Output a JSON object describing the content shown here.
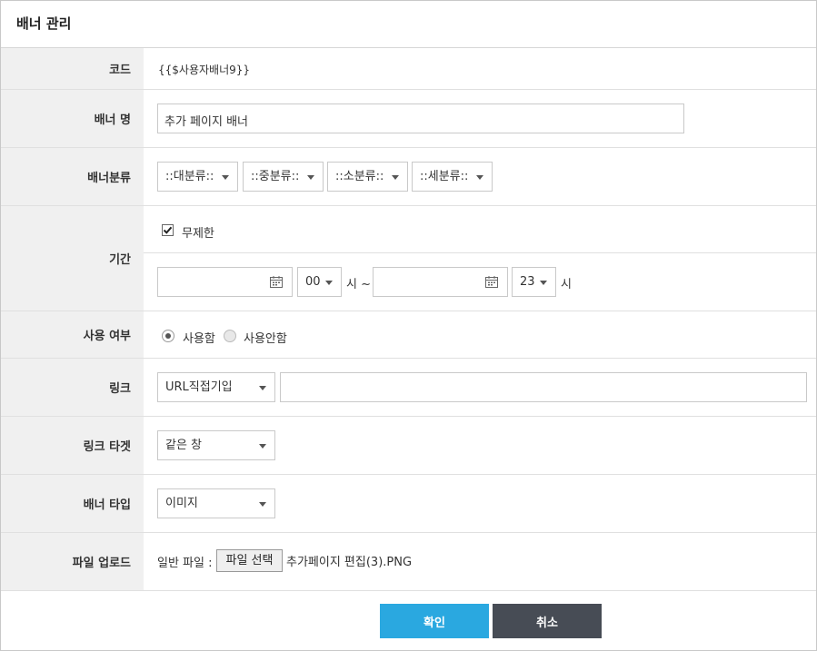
{
  "dialog": {
    "title": "배너 관리"
  },
  "code": {
    "label": "코드",
    "value": "{{$사용자배너9}}"
  },
  "name": {
    "label": "배너 명",
    "value": "추가 페이지 배너"
  },
  "category": {
    "label": "배너분류",
    "large": "::대분류::",
    "medium": "::중분류::",
    "small": "::소분류::",
    "detail": "::세분류::"
  },
  "period": {
    "label": "기간",
    "unlimited_label": "무제한",
    "unlimited_checked": true,
    "start_date": "",
    "start_hour": "00",
    "hour_unit_start": "시 ~",
    "end_date": "",
    "end_hour": "23",
    "hour_unit_end": "시"
  },
  "usage": {
    "label": "사용 여부",
    "option_use": "사용함",
    "option_nouse": "사용안함",
    "selected": "사용함"
  },
  "link": {
    "label": "링크",
    "type": "URL직접기입",
    "url": ""
  },
  "link_target": {
    "label": "링크 타겟",
    "value": "같은 창"
  },
  "banner_type": {
    "label": "배너 타입",
    "value": "이미지"
  },
  "file_upload": {
    "label": "파일 업로드",
    "prefix": "일반 파일 :",
    "choose_label": "파일 선택",
    "file_name": "추가페이지 편집(3).PNG"
  },
  "actions": {
    "confirm": "확인",
    "cancel": "취소"
  },
  "colors": {
    "confirm": "#2aa8e0",
    "cancel": "#474c55",
    "label_bg": "#f0f0f0"
  },
  "icons": [
    "calendar-icon",
    "checkbox-checked-icon",
    "radio-selected-icon",
    "radio-empty-icon",
    "chevron-down-icon"
  ]
}
